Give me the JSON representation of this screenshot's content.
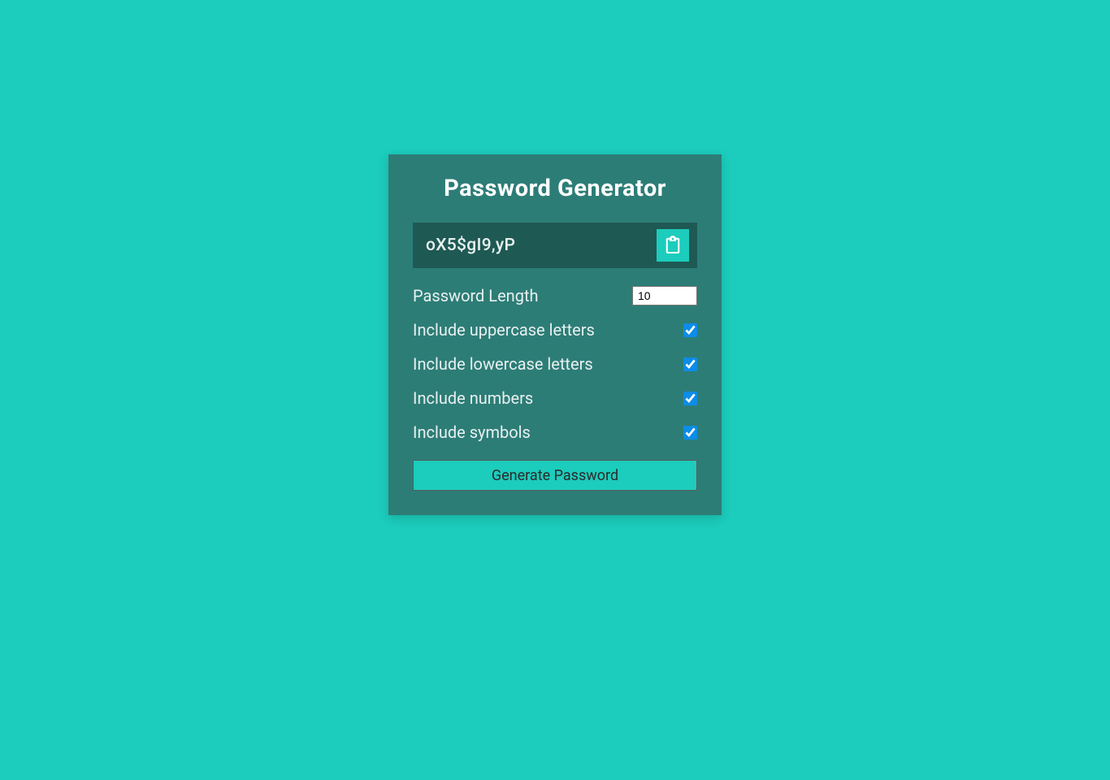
{
  "title": "Password Generator",
  "result": {
    "password": "oX5$gI9,yP"
  },
  "settings": {
    "length": {
      "label": "Password Length",
      "value": "10"
    },
    "uppercase": {
      "label": "Include uppercase letters",
      "checked": true
    },
    "lowercase": {
      "label": "Include lowercase letters",
      "checked": true
    },
    "numbers": {
      "label": "Include numbers",
      "checked": true
    },
    "symbols": {
      "label": "Include symbols",
      "checked": true
    }
  },
  "generate_label": "Generate Password"
}
